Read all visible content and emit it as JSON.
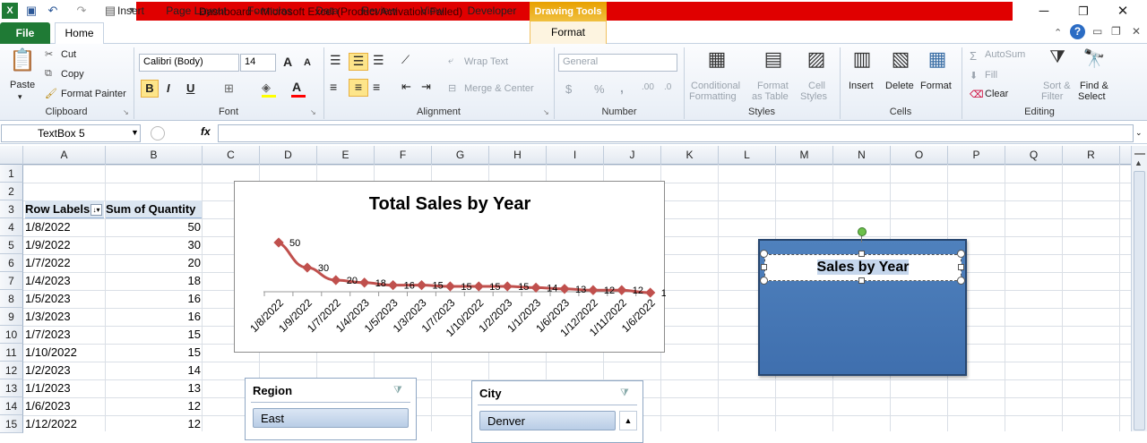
{
  "window": {
    "title": "Dashboard  -  Microsoft Excel (Product Activation Failed)",
    "context_tab_group": "Drawing Tools"
  },
  "tabs": [
    "File",
    "Home",
    "Insert",
    "Page Layout",
    "Formulas",
    "Data",
    "Review",
    "View",
    "Developer",
    "Format"
  ],
  "ribbon": {
    "clipboard": {
      "label": "Clipboard",
      "paste": "Paste",
      "cut": "Cut",
      "copy": "Copy",
      "format_painter": "Format Painter"
    },
    "font": {
      "label": "Font",
      "family": "Calibri (Body)",
      "size": "14",
      "bold": "B",
      "italic": "I",
      "underline": "U",
      "grow": "A",
      "shrink": "A"
    },
    "alignment": {
      "label": "Alignment",
      "wrap_text": "Wrap Text",
      "merge_center": "Merge & Center"
    },
    "number": {
      "label": "Number",
      "format": "General",
      "currency": "$",
      "percent": "%",
      "comma": ",",
      "inc_decimal": ".00",
      "dec_decimal": ".0"
    },
    "styles": {
      "label": "Styles",
      "conditional": "Conditional",
      "conditional2": "Formatting",
      "format_as": "Format",
      "format_as2": "as Table",
      "cell": "Cell",
      "cell2": "Styles"
    },
    "cells": {
      "label": "Cells",
      "insert": "Insert",
      "delete": "Delete",
      "format": "Format"
    },
    "editing": {
      "label": "Editing",
      "autosum": "AutoSum",
      "fill": "Fill",
      "clear": "Clear",
      "sort": "Sort &",
      "sort2": "Filter",
      "find": "Find &",
      "find2": "Select"
    }
  },
  "formula_bar": {
    "name_box": "TextBox 5",
    "fx": "fx",
    "value": ""
  },
  "columns": [
    "A",
    "B",
    "C",
    "D",
    "E",
    "F",
    "G",
    "H",
    "I",
    "J",
    "K",
    "L",
    "M",
    "N",
    "O",
    "P",
    "Q",
    "R"
  ],
  "rows": [
    "1",
    "2",
    "3",
    "4",
    "5",
    "6",
    "7",
    "8",
    "9",
    "10",
    "11",
    "12",
    "13",
    "14",
    "15"
  ],
  "pivot": {
    "header_a": "Row Labels",
    "header_b": "Sum of Quantity",
    "rows": [
      {
        "label": "1/8/2022",
        "value": "50"
      },
      {
        "label": "1/9/2022",
        "value": "30"
      },
      {
        "label": "1/7/2022",
        "value": "20"
      },
      {
        "label": "1/4/2023",
        "value": "18"
      },
      {
        "label": "1/5/2023",
        "value": "16"
      },
      {
        "label": "1/3/2023",
        "value": "16"
      },
      {
        "label": "1/7/2023",
        "value": "15"
      },
      {
        "label": "1/10/2022",
        "value": "15"
      },
      {
        "label": "1/2/2023",
        "value": "14"
      },
      {
        "label": "1/1/2023",
        "value": "13"
      },
      {
        "label": "1/6/2023",
        "value": "12"
      },
      {
        "label": "1/12/2022",
        "value": "12"
      }
    ]
  },
  "chart_data": {
    "type": "line",
    "title": "Total Sales by Year",
    "categories": [
      "1/8/2022",
      "1/9/2022",
      "1/7/2022",
      "1/4/2023",
      "1/5/2023",
      "1/3/2023",
      "1/7/2023",
      "1/10/2022",
      "1/2/2023",
      "1/1/2023",
      "1/6/2023",
      "1/12/2022",
      "1/11/2022",
      "1/6/2022"
    ],
    "series": [
      {
        "values": [
          50,
          30,
          20,
          18,
          16,
          16,
          15,
          15,
          15,
          14,
          13,
          12,
          12,
          10
        ]
      }
    ],
    "labels": [
      "50",
      "30",
      "20",
      "18",
      "16",
      "15",
      "15",
      "15",
      "15",
      "14",
      "13",
      "12",
      "12",
      "10",
      "10"
    ],
    "color": "#c0504d"
  },
  "slicers": {
    "region": {
      "title": "Region",
      "item": "East"
    },
    "city": {
      "title": "City",
      "item": "Denver"
    }
  },
  "textbox": {
    "text": "Sales by Year"
  },
  "colors": {
    "file_tab": "#1f7a35",
    "title_red": "#e00000",
    "shape_fill": "#4f81bd",
    "line": "#c0504d"
  }
}
